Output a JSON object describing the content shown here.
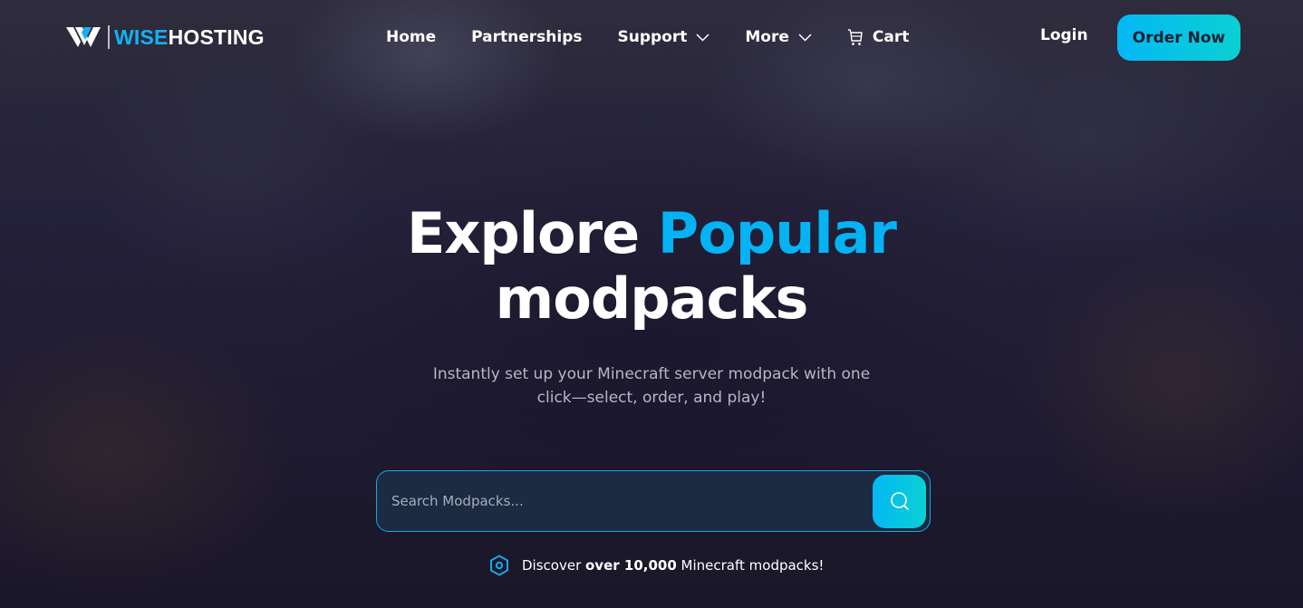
{
  "brand": {
    "name_part1": "WISE",
    "name_part2": "HOSTING",
    "logo_icon": "wisehosting-w-logo",
    "accent_color": "#05b3f4"
  },
  "nav": {
    "items": [
      {
        "label": "Home",
        "icon": null,
        "dropdown": false
      },
      {
        "label": "Partnerships",
        "icon": null,
        "dropdown": false
      },
      {
        "label": "Support",
        "icon": null,
        "dropdown": true
      },
      {
        "label": "More",
        "icon": null,
        "dropdown": true
      },
      {
        "label": "Cart",
        "icon": "cart-icon",
        "dropdown": false
      }
    ],
    "login_label": "Login",
    "order_label": "Order Now"
  },
  "hero": {
    "title_part1": "Explore ",
    "title_accent": "Popular",
    "title_part2": "modpacks",
    "subtitle_line1": "Instantly set up your Minecraft server modpack with one",
    "subtitle_line2": "click—select, order, and play!"
  },
  "search": {
    "placeholder": "Search Modpacks...",
    "value": "",
    "button_icon": "search-icon"
  },
  "discover": {
    "icon": "hexagon-icon",
    "prefix": "Discover ",
    "bold": "over 10,000",
    "suffix": " Minecraft modpacks!"
  }
}
